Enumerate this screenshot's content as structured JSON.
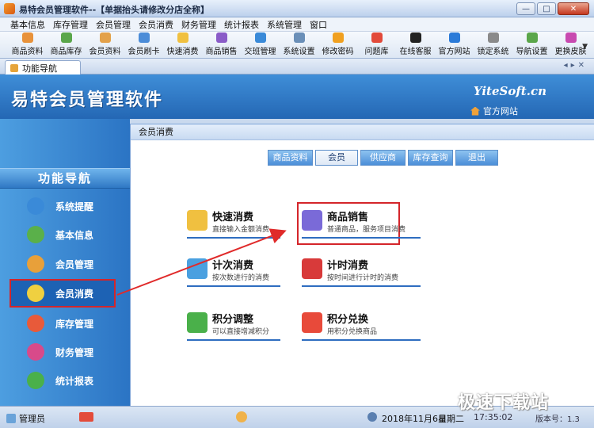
{
  "window": {
    "title": "易特会员管理软件--【单据抬头请修改分店全称】"
  },
  "menu": [
    "基本信息",
    "库存管理",
    "会员管理",
    "会员消费",
    "财务管理",
    "统计报表",
    "系统管理",
    "窗口"
  ],
  "toolbar": [
    {
      "label": "商品资料",
      "color": "#e8923a"
    },
    {
      "label": "商品库存",
      "color": "#5aa64a"
    },
    {
      "label": "会员资料",
      "color": "#e3a14a"
    },
    {
      "label": "会员刷卡",
      "color": "#4b8cd8"
    },
    {
      "label": "快速消费",
      "color": "#f0c040"
    },
    {
      "label": "商品销售",
      "color": "#8a5cc8"
    },
    {
      "label": "交班管理",
      "color": "#3a8ad8"
    },
    {
      "label": "系统设置",
      "color": "#6a8fb8"
    },
    {
      "label": "修改密码",
      "color": "#f0a020"
    },
    {
      "label": "问题库",
      "color": "#e24a3a"
    },
    {
      "label": "在线客服",
      "color": "#222222"
    },
    {
      "label": "官方网站",
      "color": "#2a7ad8"
    },
    {
      "label": "锁定系统",
      "color": "#8a8a8a"
    },
    {
      "label": "导航设置",
      "color": "#5aa64a"
    },
    {
      "label": "更换皮肤",
      "color": "#c84ab0"
    }
  ],
  "doc_tab": "功能导航",
  "banner": {
    "brand": "易特会员管理软件",
    "logo": "YiteSoft.cn",
    "site_link": "官方网站"
  },
  "sidebar": {
    "title": "功能导航",
    "items": [
      {
        "label": "系统提醒",
        "color": "#3a8ad8"
      },
      {
        "label": "基本信息",
        "color": "#5ab04a"
      },
      {
        "label": "会员管理",
        "color": "#e8a03a"
      },
      {
        "label": "会员消费",
        "color": "#f0d040"
      },
      {
        "label": "库存管理",
        "color": "#e85a3a"
      },
      {
        "label": "财务管理",
        "color": "#d84a8a"
      },
      {
        "label": "统计报表",
        "color": "#4ab04a"
      }
    ]
  },
  "panel": {
    "header": "会员消费",
    "module_buttons": [
      "商品资料",
      "会员",
      "供应商",
      "库存查询",
      "退出"
    ],
    "functions": [
      {
        "name": "快速消费",
        "desc": "直接输入金额消费",
        "color": "#f0c040"
      },
      {
        "name": "商品销售",
        "desc": "普通商品，服务项目消费",
        "color": "#7a6ad8"
      },
      {
        "name": "计次消费",
        "desc": "按次数进行的消费",
        "color": "#4aa0e0"
      },
      {
        "name": "计时消费",
        "desc": "按时间进行计时的消费",
        "color": "#d83a3a"
      },
      {
        "name": "积分调整",
        "desc": "可以直接增减积分",
        "color": "#4ab04a"
      },
      {
        "name": "积分兑换",
        "desc": "用积分兑换商品",
        "color": "#e84a3a"
      }
    ]
  },
  "status": {
    "user": "管理员",
    "date": "2018年11月6日",
    "weekday": "星期二",
    "time": "17:35:02",
    "version": "版本号：1.3"
  },
  "watermark": "极速下载站"
}
